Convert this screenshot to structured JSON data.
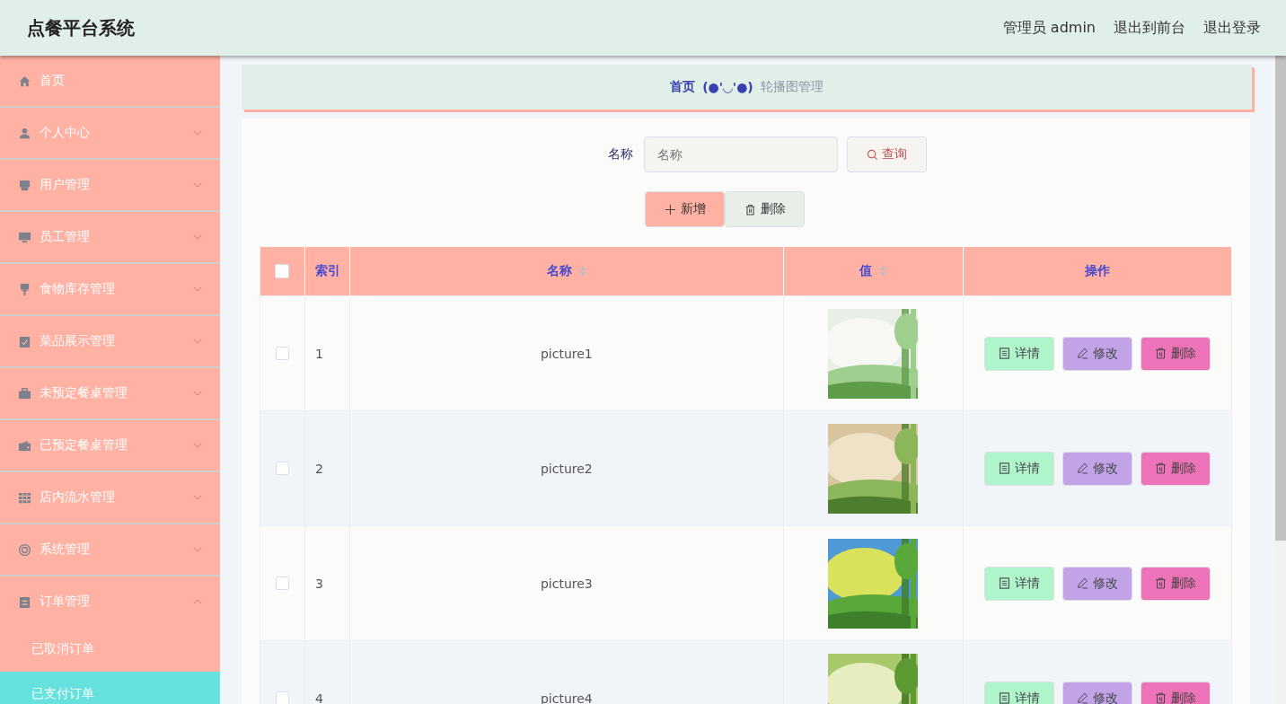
{
  "header": {
    "title": "点餐平台系统",
    "user": "管理员 admin",
    "links": [
      "退出到前台",
      "退出登录"
    ]
  },
  "sidebar": {
    "items": [
      {
        "kind": "link",
        "label": "首页"
      },
      {
        "kind": "menu",
        "label": "个人中心",
        "expanded": false
      },
      {
        "kind": "menu",
        "label": "用户管理",
        "expanded": false
      },
      {
        "kind": "menu",
        "label": "员工管理",
        "expanded": false
      },
      {
        "kind": "menu",
        "label": "食物库存管理",
        "expanded": false
      },
      {
        "kind": "menu",
        "label": "菜品展示管理",
        "expanded": false
      },
      {
        "kind": "menu",
        "label": "未预定餐桌管理",
        "expanded": false
      },
      {
        "kind": "menu",
        "label": "已预定餐桌管理",
        "expanded": false
      },
      {
        "kind": "menu",
        "label": "店内流水管理",
        "expanded": false
      },
      {
        "kind": "menu",
        "label": "系统管理",
        "expanded": false
      },
      {
        "kind": "menu",
        "label": "订单管理",
        "expanded": true,
        "children": [
          {
            "label": "已取消订单",
            "selected": false
          },
          {
            "label": "已支付订单",
            "selected": true
          }
        ]
      }
    ]
  },
  "breadcrumb": {
    "home": "首页",
    "separator": "(●'◡'●)",
    "current": "轮播图管理"
  },
  "search": {
    "label": "名称",
    "placeholder": "名称",
    "button": "查询"
  },
  "actions": [
    "新增",
    "删除"
  ],
  "table": {
    "columns": [
      {
        "label": "索引",
        "sortable": false
      },
      {
        "label": "名称",
        "sortable": true
      },
      {
        "label": "值",
        "sortable": true
      },
      {
        "label": "操作",
        "sortable": false
      }
    ],
    "header_checked": false,
    "rows": [
      {
        "checked": false,
        "index": "1",
        "name": "picture1",
        "value": {
          "kind": "picture"
        },
        "buttons": [
          "详情",
          "修改",
          "删除"
        ]
      },
      {
        "checked": false,
        "index": "2",
        "name": "picture2",
        "value": {
          "kind": "picture"
        },
        "buttons": [
          "详情",
          "修改",
          "删除"
        ]
      },
      {
        "checked": false,
        "index": "3",
        "name": "picture3",
        "value": {
          "kind": "picture"
        },
        "buttons": [
          "详情",
          "修改",
          "删除"
        ]
      },
      {
        "checked": false,
        "index": "4",
        "name": "picture4",
        "value": {
          "kind": "picture"
        },
        "buttons": [
          "详情",
          "修改",
          "删除"
        ]
      }
    ]
  }
}
